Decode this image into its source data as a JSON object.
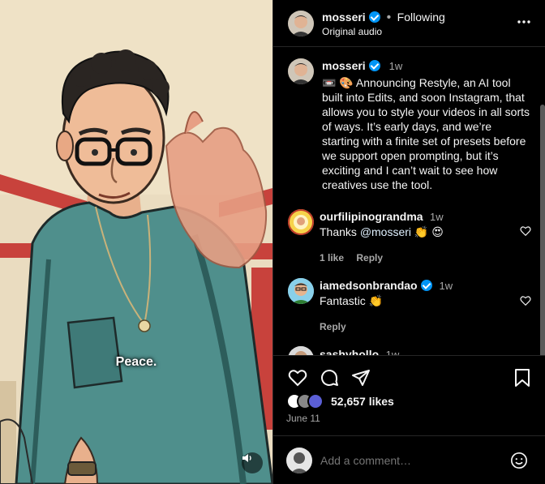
{
  "video": {
    "caption": "Peace.",
    "audio_icon": "speaker-icon"
  },
  "header": {
    "username": "mosseri",
    "separator": "•",
    "follow_status": "Following",
    "audio": "Original audio",
    "more_icon": "more-horizontal-icon"
  },
  "post": {
    "username": "mosseri",
    "time": "1w",
    "emoji": "📼 🎨",
    "text": "Announcing Restyle, an AI tool built into Edits, and soon Instagram, that allows you to style your videos in all sorts of ways. It’s early days, and we’re starting with a finite set of presets before we support open prompting, but it’s exciting and I can’t wait to see how creatives use the tool."
  },
  "comments": [
    {
      "username": "ourfilipinograndma",
      "time": "1w",
      "text_prefix": "Thanks ",
      "mention": "@mosseri",
      "text_suffix": " 👏 😍",
      "likes": "1 like",
      "reply": "Reply"
    },
    {
      "username": "iamedsonbrandao",
      "time": "1w",
      "text": "Fantastic 👏",
      "reply": "Reply"
    },
    {
      "username": "sashyhollo",
      "time": "1w"
    }
  ],
  "actions": {
    "likes": "52,657 likes",
    "date": "June 11"
  },
  "add_comment": {
    "placeholder": "Add a comment…"
  },
  "colors": {
    "verified": "#0095f6",
    "muted": "#a8a8a8",
    "shirt": "#4d8f8c",
    "background": "#000000"
  }
}
